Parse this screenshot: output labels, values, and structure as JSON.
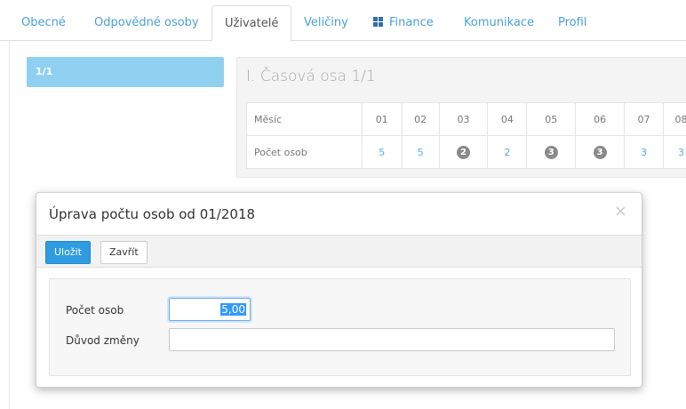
{
  "tabs": [
    {
      "label": "Obecné"
    },
    {
      "label": "Odpovědné osoby"
    },
    {
      "label": "Uživatelé",
      "active": true
    },
    {
      "label": "Veličiny"
    },
    {
      "label": "Finance",
      "icon": "grid-icon"
    },
    {
      "label": "Komunikace"
    },
    {
      "label": "Profil"
    }
  ],
  "sidebar": {
    "page_label": "1/1"
  },
  "timeline": {
    "title": "I. Časová osa 1/1",
    "row_month_label": "Měsíc",
    "row_count_label": "Počet osob",
    "months": [
      "01",
      "02",
      "03",
      "04",
      "05",
      "06",
      "07",
      "08"
    ],
    "counts": [
      {
        "value": "5",
        "badge": false
      },
      {
        "value": "5",
        "badge": false
      },
      {
        "value": "2",
        "badge": true
      },
      {
        "value": "2",
        "badge": false
      },
      {
        "value": "3",
        "badge": true
      },
      {
        "value": "3",
        "badge": true
      },
      {
        "value": "3",
        "badge": false
      },
      {
        "value": "3",
        "badge": false
      }
    ]
  },
  "modal": {
    "title": "Úprava počtu osob od 01/2018",
    "close_symbol": "×",
    "save_label": "Uložit",
    "close_label": "Zavřít",
    "fields": {
      "count_label": "Počet osob",
      "count_value": "5,00",
      "reason_label": "Důvod změny",
      "reason_value": ""
    }
  },
  "colors": {
    "accent": "#2f9be0",
    "link": "#4a9fd8",
    "pill": "#8fd0f0",
    "badge": "#8a8a8a"
  }
}
